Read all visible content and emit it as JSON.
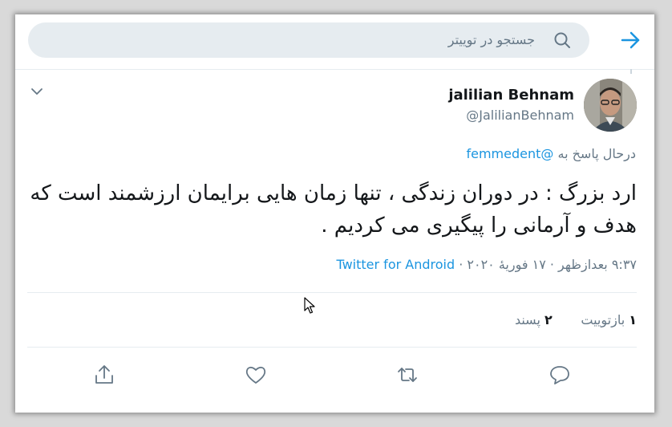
{
  "search": {
    "placeholder": "جستجو در توییتر"
  },
  "icons": {
    "back": "arrow-right-icon",
    "search": "search-icon",
    "menu": "chevron-down-icon",
    "reply": "reply-icon",
    "retweet": "retweet-icon",
    "like": "heart-icon",
    "share": "share-icon"
  },
  "colors": {
    "accent": "#1b95e0",
    "muted": "#657786",
    "divider": "#e6ecf0"
  },
  "tweet": {
    "display_name": "jalilian Behnam",
    "handle": "@JalilianBehnam",
    "reply_prefix": "درحال پاسخ به",
    "reply_to": "@femmedent",
    "text": "ارد بزرگ : در دوران زندگی ، تنها زمان هایی برایمان ارزشمند است که هدف و آرمانی را پیگیری می کردیم .",
    "timestamp": "۹:۳۷ بعدازظهر · ۱۷ فوریهٔ ۲۰۲۰",
    "separator": " · ",
    "source": "Twitter for Android"
  },
  "stats": {
    "retweets_count": "۱",
    "retweets_label": "بازتوییت",
    "likes_count": "۲",
    "likes_label": "پسند"
  }
}
